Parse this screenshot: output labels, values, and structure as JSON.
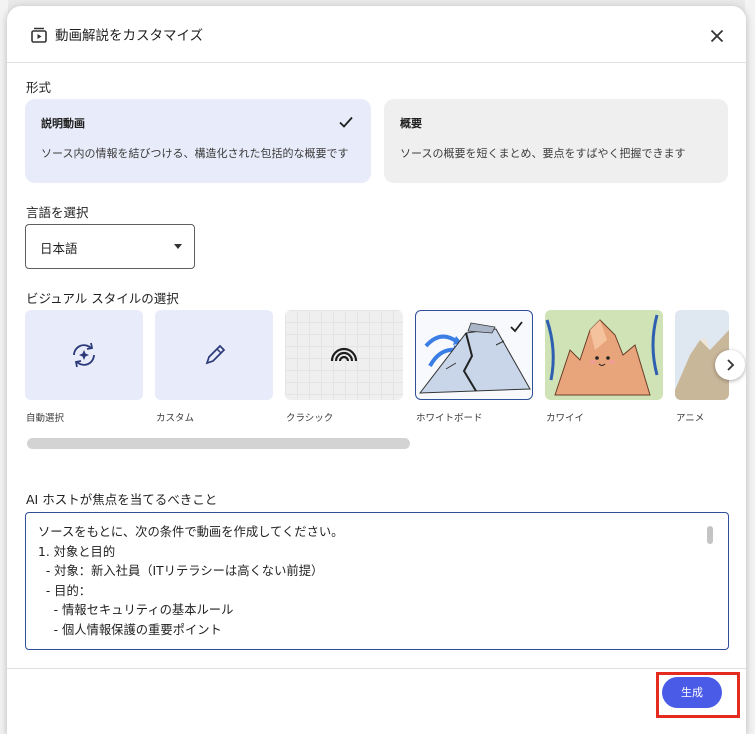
{
  "dialog": {
    "title": "動画解説をカスタマイズ",
    "close_icon": "close-icon"
  },
  "format": {
    "label": "形式",
    "options": [
      {
        "title": "説明動画",
        "description": "ソース内の情報を結びつける、構造化された包括的な概要です",
        "selected": true
      },
      {
        "title": "概要",
        "description": "ソースの概要を短くまとめ、要点をすばやく把握できます",
        "selected": false
      }
    ]
  },
  "language": {
    "label": "言語を選択",
    "value": "日本語"
  },
  "visual_style": {
    "label": "ビジュアル スタイルの選択",
    "options": [
      {
        "label": "自動選択",
        "icon": "auto-refresh-icon"
      },
      {
        "label": "カスタム",
        "icon": "pencil-icon"
      },
      {
        "label": "クラシック",
        "icon": "rainbow-icon"
      },
      {
        "label": "ホワイトボード",
        "icon": "whiteboard-volcano-image",
        "selected": true
      },
      {
        "label": "カワイイ",
        "icon": "kawaii-mountain-image"
      },
      {
        "label": "アニメ",
        "icon": "anime-image"
      }
    ]
  },
  "focus": {
    "label": "AI ホストが焦点を当てるべきこと",
    "lines": [
      "ソースをもとに、次の条件で動画を作成してください。",
      "1. 対象と目的",
      "  - 対象：新入社員（ITリテラシーは高くない前提）",
      "  - 目的：",
      "    - 情報セキュリティの基本ルール",
      "    - 個人情報保護の重要ポイント"
    ]
  },
  "footer": {
    "generate_label": "生成"
  },
  "colors": {
    "accent": "#4a5be8",
    "selected_card": "#e8ebf9",
    "highlight": "#e52a1e"
  }
}
